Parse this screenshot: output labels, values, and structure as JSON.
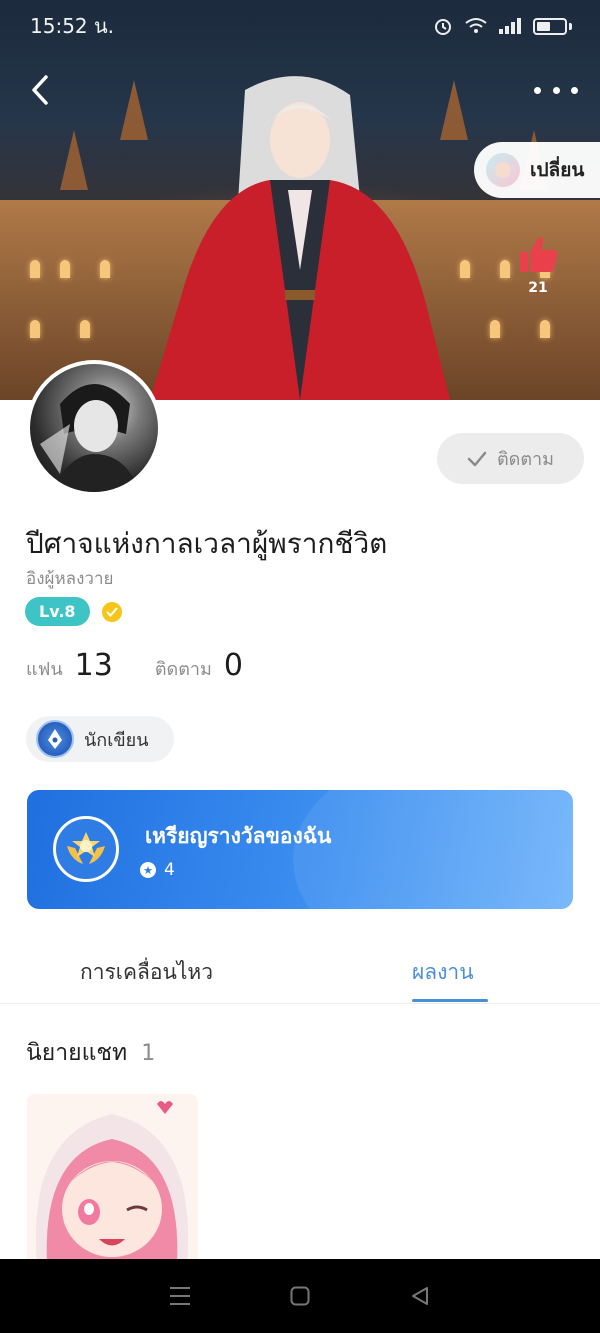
{
  "status_bar": {
    "time": "15:52 น."
  },
  "header": {
    "switch_label": "เปลี่ยน",
    "like_count": "21"
  },
  "profile": {
    "name": "ปีศาจแห่งกาลเวลาผู้พรากชีวิต",
    "subtitle": "อิงผู้หลงวาย",
    "level": "Lv.8",
    "follow_button": "ติดตาม",
    "stats": [
      {
        "label": "แฟน",
        "value": "13"
      },
      {
        "label": "ติดตาม",
        "value": "0"
      }
    ],
    "role_badge": "นักเขียน"
  },
  "medal_card": {
    "title": "เหรียญรางวัลของฉัน",
    "count": "4"
  },
  "tabs": [
    {
      "label": "การเคลื่อนไหว",
      "active": false
    },
    {
      "label": "ผลงาน",
      "active": true
    }
  ],
  "section": {
    "title": "นิยายแชท",
    "count": "1"
  },
  "colors": {
    "accent_blue": "#4a90d9",
    "level_teal": "#3fc4c6",
    "medal_gradient_start": "#1f6fe0",
    "medal_gradient_end": "#6eb3fb",
    "like_red": "#e8414b"
  },
  "icons": {
    "back": "chevron-left-icon",
    "more": "more-dots-icon",
    "like": "thumbs-up-icon",
    "follow_check": "check-icon",
    "verified": "verified-badge-icon",
    "writer": "pen-nib-icon",
    "medal": "medal-icon"
  }
}
